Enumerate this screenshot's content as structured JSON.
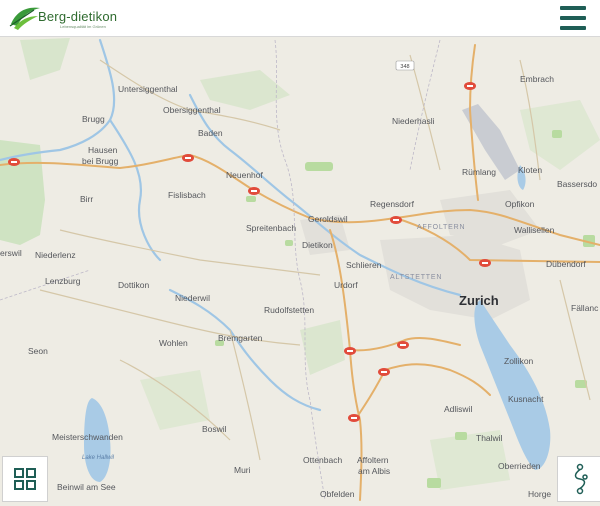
{
  "header": {
    "logo_text": "Berg-dietikon",
    "logo_subtitle": "Lebensqualität im Grünen",
    "menu_icon": "hamburger-menu-icon"
  },
  "map": {
    "city_label": "Zurich",
    "place_labels": [
      {
        "id": "untersiggenthal",
        "text": "Untersiggenthal"
      },
      {
        "id": "obersiggenthal",
        "text": "Obersiggenthal"
      },
      {
        "id": "brugg",
        "text": "Brugg"
      },
      {
        "id": "hausen",
        "text": "Hausen"
      },
      {
        "id": "bei-brugg",
        "text": "bei Brugg"
      },
      {
        "id": "baden",
        "text": "Baden"
      },
      {
        "id": "birr",
        "text": "Birr"
      },
      {
        "id": "fislisbach",
        "text": "Fislisbach"
      },
      {
        "id": "neuenhof",
        "text": "Neuenhof"
      },
      {
        "id": "niederlenz",
        "text": "Niederlenz"
      },
      {
        "id": "erswil",
        "text": "erswil"
      },
      {
        "id": "lenzburg",
        "text": "Lenzburg"
      },
      {
        "id": "dottikon",
        "text": "Dottikon"
      },
      {
        "id": "niederwil",
        "text": "Niederwil"
      },
      {
        "id": "spreitenbach",
        "text": "Spreitenbach"
      },
      {
        "id": "geroldswil",
        "text": "Geroldswil"
      },
      {
        "id": "dietikon",
        "text": "Dietikon"
      },
      {
        "id": "regensdorf",
        "text": "Regensdorf"
      },
      {
        "id": "niederhasli",
        "text": "Niederhasli"
      },
      {
        "id": "embrach",
        "text": "Embrach"
      },
      {
        "id": "rumlang",
        "text": "Rümlang"
      },
      {
        "id": "kloten",
        "text": "Kloten"
      },
      {
        "id": "bassersdorf",
        "text": "Bassersdo"
      },
      {
        "id": "opfikon",
        "text": "Opfikon"
      },
      {
        "id": "wallisellen",
        "text": "Wallisellen"
      },
      {
        "id": "dubendorf",
        "text": "Dübendorf"
      },
      {
        "id": "schlieren",
        "text": "Schlieren"
      },
      {
        "id": "urdorf",
        "text": "Urdorf"
      },
      {
        "id": "rudolfstetten",
        "text": "Rudolfstetten"
      },
      {
        "id": "bremgarten",
        "text": "Bremgarten"
      },
      {
        "id": "wohlen",
        "text": "Wohlen"
      },
      {
        "id": "seon",
        "text": "Seon"
      },
      {
        "id": "zollikon",
        "text": "Zollikon"
      },
      {
        "id": "kusnacht",
        "text": "Kusnacht"
      },
      {
        "id": "adliswil",
        "text": "Adliswil"
      },
      {
        "id": "thalwil",
        "text": "Thalwil"
      },
      {
        "id": "faellanden",
        "text": "Fällanc"
      },
      {
        "id": "meisterschwanden",
        "text": "Meisterschwanden"
      },
      {
        "id": "boswil",
        "text": "Boswil"
      },
      {
        "id": "muri",
        "text": "Muri"
      },
      {
        "id": "ottenbach",
        "text": "Ottenbach"
      },
      {
        "id": "affoltern",
        "text": "Affoltern"
      },
      {
        "id": "am-albis",
        "text": "am Albis"
      },
      {
        "id": "oberrieden",
        "text": "Oberrieden"
      },
      {
        "id": "beinwil",
        "text": "Beinwil am See"
      },
      {
        "id": "obfelden",
        "text": "Obfelden"
      },
      {
        "id": "horgen",
        "text": "Horge"
      }
    ],
    "district_labels": [
      {
        "id": "affoltern-district",
        "text": "AFFOLTERN"
      },
      {
        "id": "altstetten-district",
        "text": "ALTSTETTEN"
      }
    ],
    "lake_labels": [
      {
        "id": "hallwil",
        "text": "Lake Hallwil"
      }
    ],
    "road_shield": "348"
  },
  "controls": {
    "grid_icon": "grid-icon",
    "route_icon": "route-icon"
  }
}
